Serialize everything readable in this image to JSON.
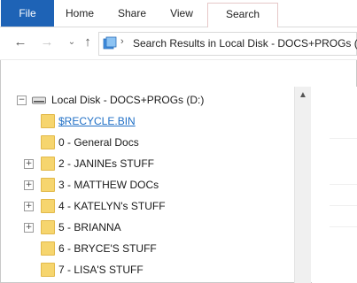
{
  "ribbon": {
    "tabs": [
      {
        "label": "File"
      },
      {
        "label": "Home"
      },
      {
        "label": "Share"
      },
      {
        "label": "View"
      },
      {
        "label": "Search"
      }
    ]
  },
  "nav": {
    "back_icon": "back-arrow-icon",
    "forward_icon": "forward-arrow-icon",
    "history_icon": "chevron-down-icon",
    "up_icon": "up-arrow-icon"
  },
  "address": {
    "icon": "search-results-icon",
    "path": "Search Results in Local Disk - DOCS+PROGs (D:)"
  },
  "tree": {
    "root": {
      "label": "Local Disk - DOCS+PROGs (D:)",
      "expander": "−",
      "icon": "drive-icon"
    },
    "items": [
      {
        "label": "$RECYCLE.BIN",
        "expander": "",
        "link": true
      },
      {
        "label": "0 - General Docs",
        "expander": ""
      },
      {
        "label": "2 - JANINEs STUFF",
        "expander": "+"
      },
      {
        "label": "3 - MATTHEW DOCs",
        "expander": "+"
      },
      {
        "label": "4 - KATELYN's STUFF",
        "expander": "+"
      },
      {
        "label": "5 - BRIANNA",
        "expander": "+"
      },
      {
        "label": "6 - BRYCE'S STUFF",
        "expander": ""
      },
      {
        "label": "7 - LISA'S STUFF",
        "expander": ""
      }
    ]
  },
  "colors": {
    "file_tab": "#1e63b6",
    "folder": "#f6d56e",
    "link": "#1f6fc6"
  }
}
